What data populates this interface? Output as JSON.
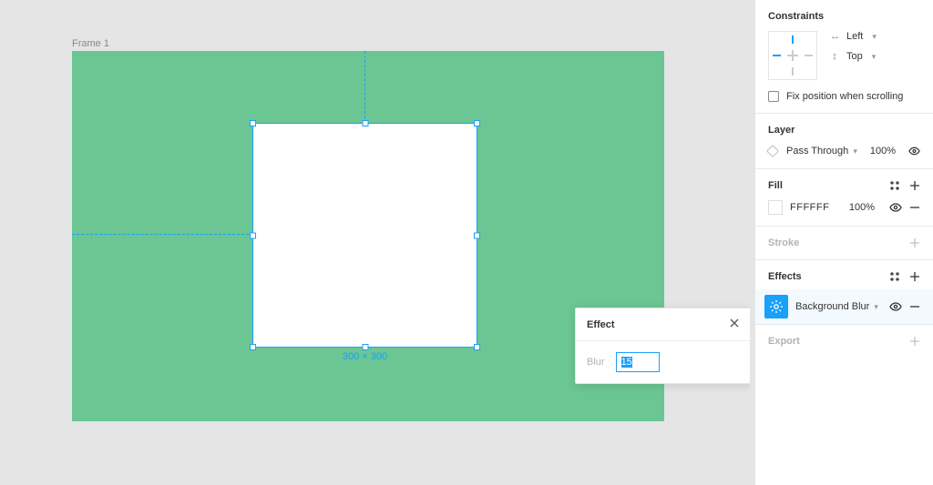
{
  "canvas": {
    "frame_label": "Frame 1",
    "selection_size_label": "300 × 300"
  },
  "inspector": {
    "constraints": {
      "title": "Constraints",
      "horizontal": "Left",
      "vertical": "Top",
      "fix_label": "Fix position when scrolling"
    },
    "layer": {
      "title": "Layer",
      "blend_mode": "Pass Through",
      "opacity": "100%"
    },
    "fill": {
      "title": "Fill",
      "hex": "FFFFFF",
      "opacity": "100%"
    },
    "stroke": {
      "title": "Stroke"
    },
    "effects": {
      "title": "Effects",
      "item_name": "Background Blur"
    },
    "export": {
      "title": "Export"
    }
  },
  "popover": {
    "title": "Effect",
    "blur_label": "Blur",
    "blur_value": "15"
  }
}
